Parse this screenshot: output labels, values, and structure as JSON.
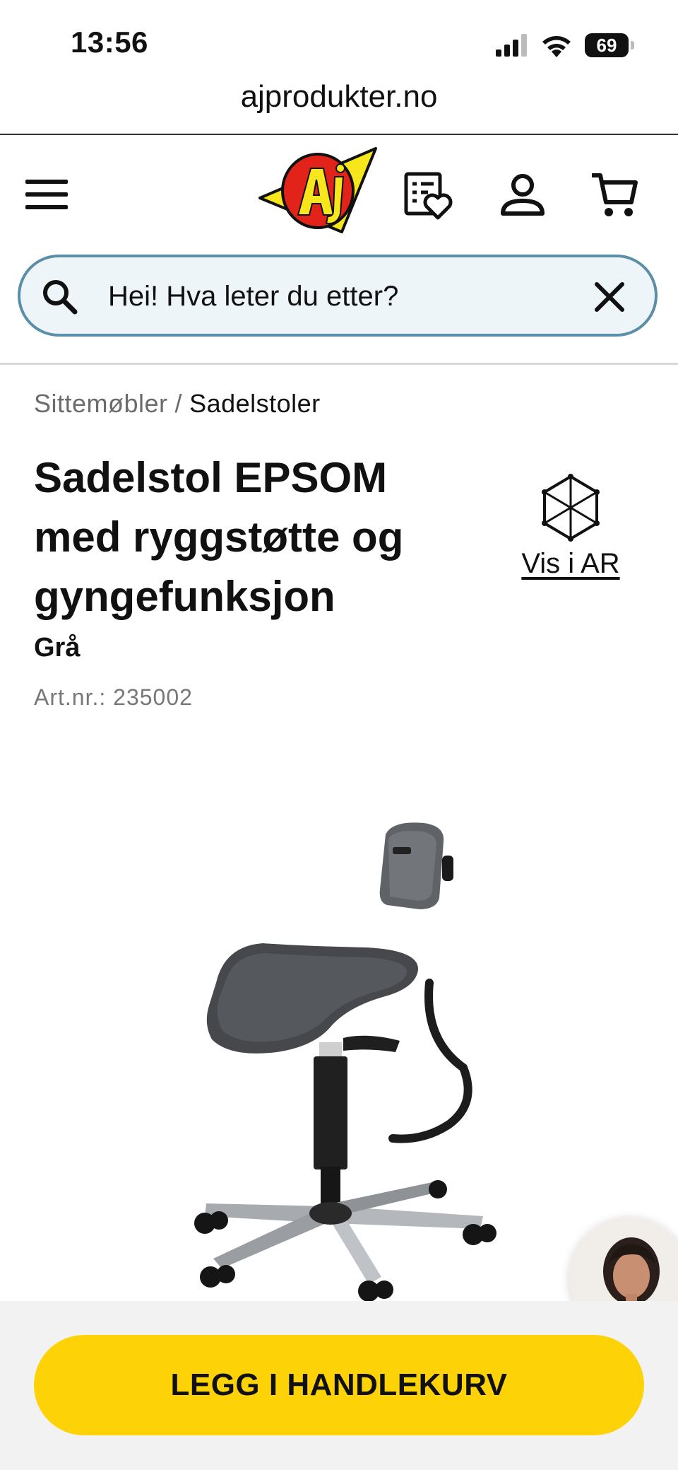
{
  "status_bar": {
    "time": "13:56",
    "battery": "69"
  },
  "browser": {
    "url": "ajprodukter.no"
  },
  "header": {
    "logo_text": "AJ",
    "icons": [
      "menu-icon",
      "wishlist-icon",
      "account-icon",
      "cart-icon"
    ]
  },
  "search": {
    "value": "Hei! Hva leter du etter?"
  },
  "breadcrumb": {
    "parent": "Sittemøbler",
    "separator": "/",
    "current": "Sadelstoler"
  },
  "product": {
    "title": "Sadelstol EPSOM med ryggstøtte og gyngefunksjon",
    "variant": "Grå",
    "article_number": "Art.nr.: 235002",
    "ar_label": "Vis i AR"
  },
  "cta": {
    "label": "LEGG I HANDLEKURV"
  },
  "colors": {
    "accent_yellow": "#fdd307",
    "search_border": "#5b8fa8",
    "search_bg": "#eef5f9",
    "logo_red": "#e2231a"
  }
}
